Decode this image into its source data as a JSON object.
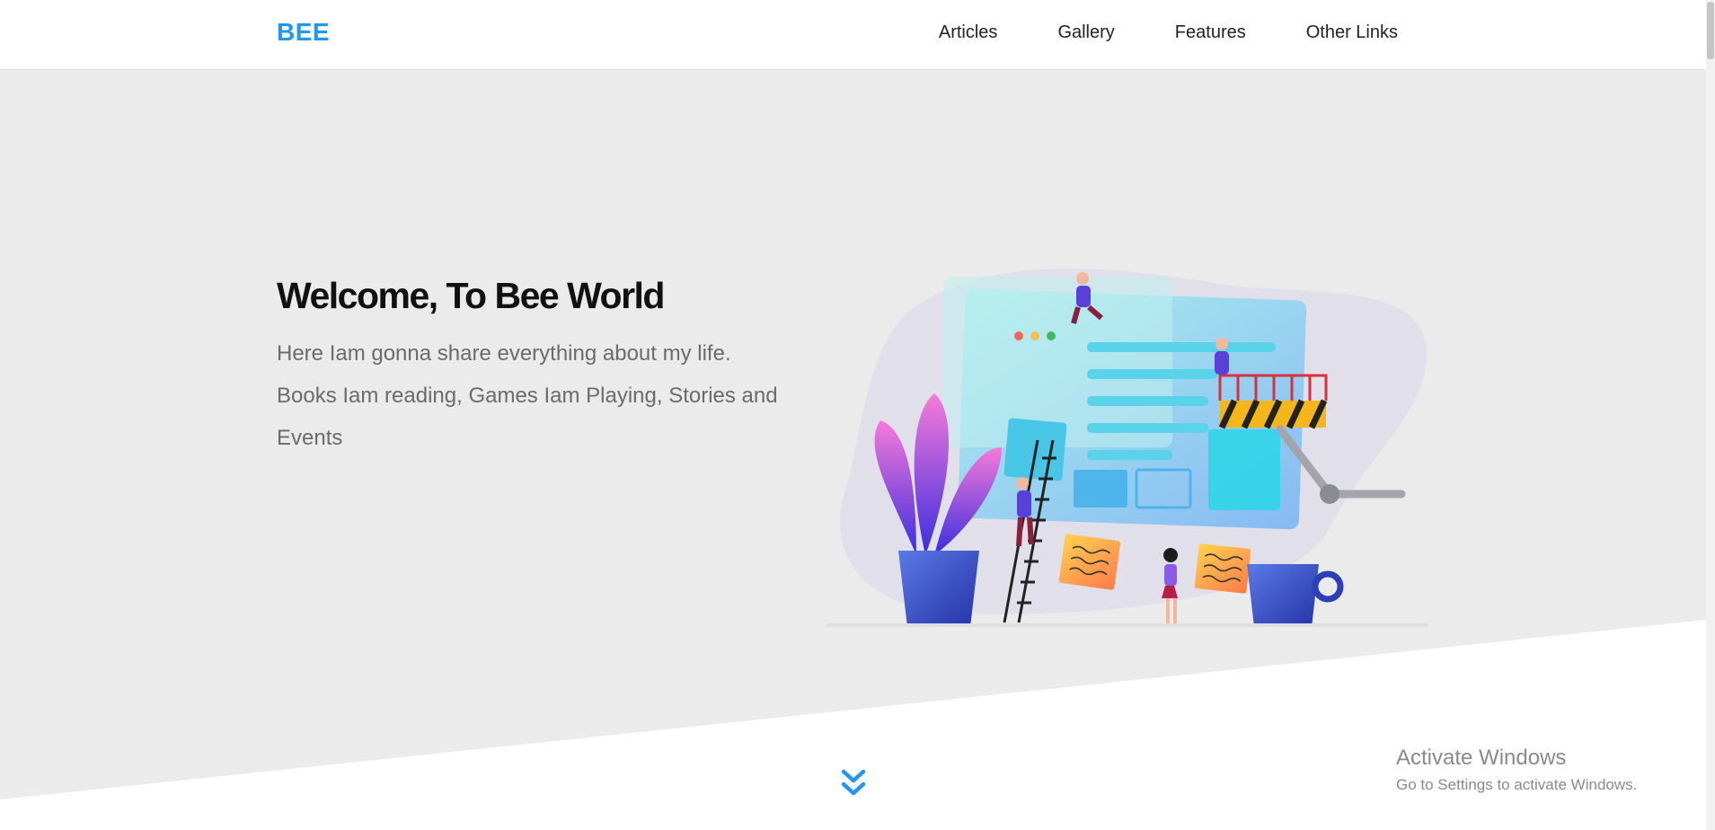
{
  "brand": {
    "logo": "BEE",
    "color": "#2196f3"
  },
  "nav": {
    "items": [
      {
        "label": "Articles"
      },
      {
        "label": "Gallery"
      },
      {
        "label": "Features"
      },
      {
        "label": "Other Links"
      }
    ]
  },
  "hero": {
    "title": "Welcome, To Bee World",
    "desc_line1": "Here Iam gonna share everything about my life.",
    "desc_line2": "Books Iam reading, Games Iam Playing, Stories and Events",
    "illustration": "website-building-illustration",
    "background": "#ebebeb"
  },
  "scroll": {
    "icon": "double-chevron-down-icon"
  },
  "watermark": {
    "title": "Activate Windows",
    "subtitle": "Go to Settings to activate Windows."
  }
}
